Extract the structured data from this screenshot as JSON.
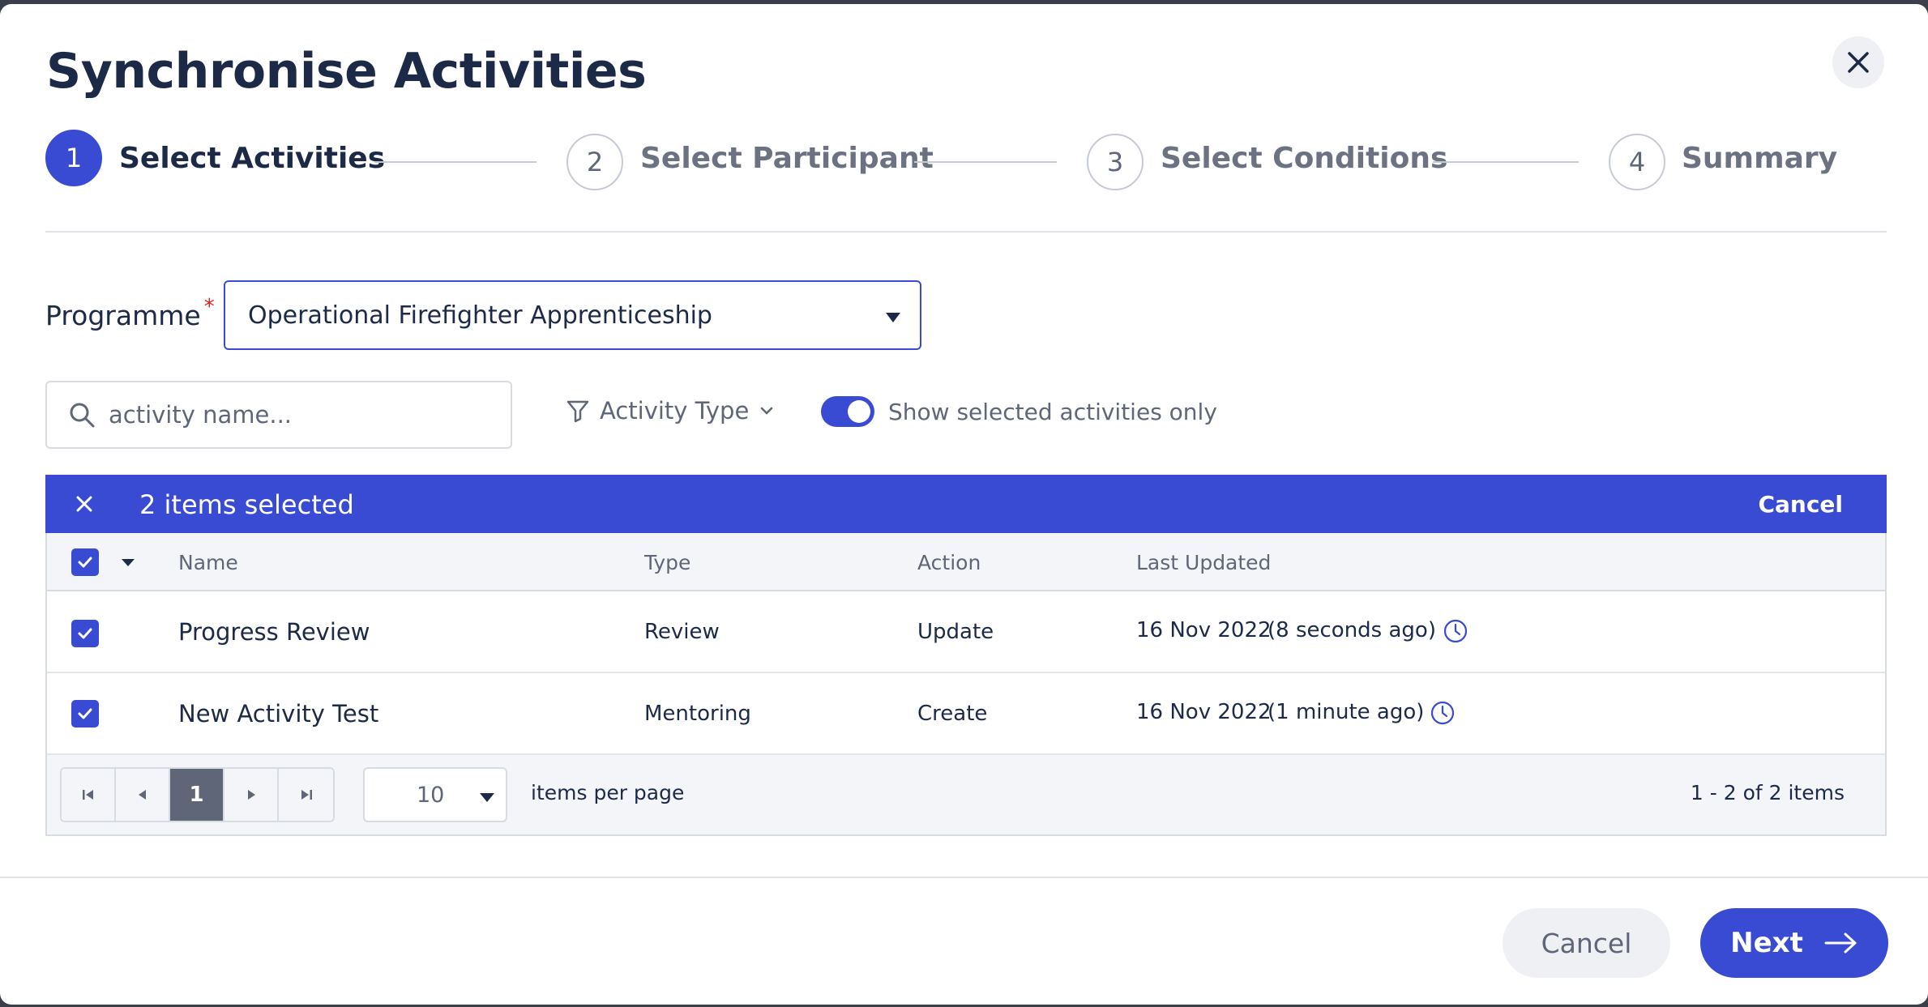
{
  "dialog": {
    "title": "Synchronise Activities"
  },
  "stepper": {
    "steps": [
      {
        "number": "1",
        "label": "Select Activities"
      },
      {
        "number": "2",
        "label": "Select Participant"
      },
      {
        "number": "3",
        "label": "Select Conditions"
      },
      {
        "number": "4",
        "label": "Summary"
      }
    ],
    "active_step": "1"
  },
  "programme": {
    "label": "Programme",
    "required_marker": "*",
    "selected_value": "Operational Firefighter Apprenticeship"
  },
  "filters": {
    "search_placeholder": "activity name...",
    "activity_type_label": "Activity Type",
    "show_selected_label": "Show selected activities only",
    "show_selected_on": true
  },
  "selection_bar": {
    "count_text": "2 items selected",
    "cancel_label": "Cancel"
  },
  "grid": {
    "columns": [
      "Name",
      "Type",
      "Action",
      "Last Updated"
    ],
    "rows": [
      {
        "name": "Progress Review",
        "type": "Review",
        "action": "Update",
        "date": "16 Nov 2022",
        "relative": "(8 seconds ago)",
        "checked": true
      },
      {
        "name": "New Activity Test",
        "type": "Mentoring",
        "action": "Create",
        "date": "16 Nov 2022",
        "relative": "(1 minute ago)",
        "checked": true
      }
    ]
  },
  "pager": {
    "current_page": "1",
    "page_size": "10",
    "page_size_label": "items per page",
    "info": "1 - 2 of 2 items"
  },
  "footer": {
    "cancel_label": "Cancel",
    "next_label": "Next"
  },
  "colors": {
    "primary": "#3a4bd3",
    "title": "#1c2a48",
    "muted": "#5e6677"
  }
}
